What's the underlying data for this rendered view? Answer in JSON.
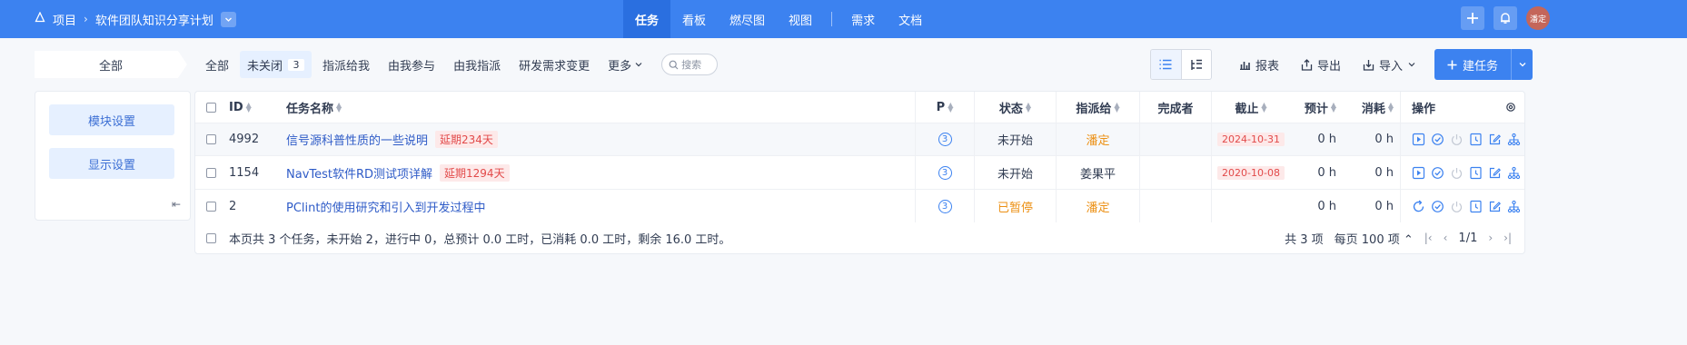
{
  "breadcrumb": {
    "root": "项目",
    "project": "软件团队知识分享计划"
  },
  "nav": {
    "tabs": [
      "任务",
      "看板",
      "燃尽图",
      "视图",
      "需求",
      "文档"
    ],
    "active": "任务"
  },
  "user": {
    "avatar_text": "潘定"
  },
  "filter": {
    "all_label": "全部",
    "tabs": [
      {
        "label": "全部"
      },
      {
        "label": "未关闭",
        "count": "3"
      },
      {
        "label": "指派给我"
      },
      {
        "label": "由我参与"
      },
      {
        "label": "由我指派"
      },
      {
        "label": "研发需求变更"
      },
      {
        "label": "更多"
      }
    ],
    "search_placeholder": "搜索"
  },
  "toolbar": {
    "report": "报表",
    "export": "导出",
    "import": "导入",
    "create": "建任务"
  },
  "side": {
    "module_settings": "模块设置",
    "display_settings": "显示设置"
  },
  "table": {
    "headers": {
      "id": "ID",
      "name": "任务名称",
      "pri": "P",
      "status": "状态",
      "assignee": "指派给",
      "finisher": "完成者",
      "deadline": "截止",
      "estimate": "预计",
      "consumed": "消耗",
      "actions": "操作"
    },
    "rows": [
      {
        "id": "4992",
        "name": "信号源科普性质的一些说明",
        "delay": "延期234天",
        "pri": "3",
        "status": "未开始",
        "assignee": "潘定",
        "finisher": "",
        "deadline": "2024-10-31",
        "estimate": "0 h",
        "consumed": "0 h"
      },
      {
        "id": "1154",
        "name": "NavTest软件RD测试项详解",
        "delay": "延期1294天",
        "pri": "3",
        "status": "未开始",
        "assignee": "姜果平",
        "finisher": "",
        "deadline": "2020-10-08",
        "estimate": "0 h",
        "consumed": "0 h"
      },
      {
        "id": "2",
        "name": "PClint的使用研究和引入到开发过程中",
        "delay": "",
        "pri": "3",
        "status": "已暂停",
        "assignee": "潘定",
        "finisher": "",
        "deadline": "",
        "estimate": "0 h",
        "consumed": "0 h"
      }
    ],
    "summary": "本页共 3 个任务，未开始 2，进行中 0，总预计 0.0 工时，已消耗 0.0 工时，剩余 16.0 工时。",
    "pager": {
      "total": "共 3 项",
      "per_page": "每页 100 项",
      "page": "1/1"
    }
  },
  "colors": {
    "primary": "#3c82f0",
    "warning": "#ec9014",
    "danger": "#e24a4a"
  }
}
